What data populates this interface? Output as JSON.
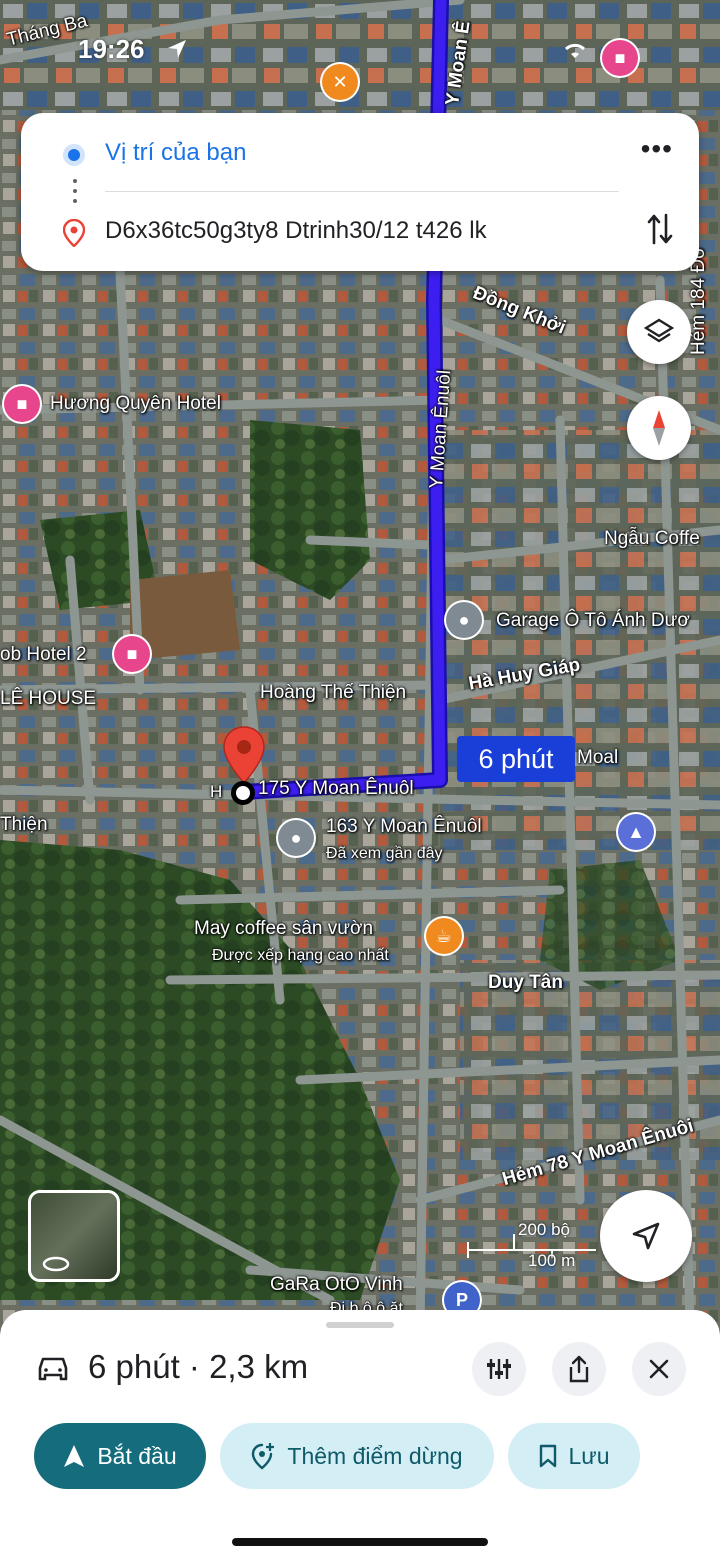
{
  "status_bar": {
    "time": "19:26"
  },
  "route_card": {
    "origin": "Vị trí của bạn",
    "destination": "D6x36tc50g3ty8 Dtrinh30/12 t426 lk"
  },
  "map": {
    "labels": {
      "thang_ba": "Tháng Ba",
      "y_moan_top": "Y Moan Ê",
      "hem_184": "Hẻm 184 Đồ",
      "dong_khoi": "Đồng Khởi",
      "y_moan_mid": "Y Moan Ênuôl",
      "huong_quyen": "Hương Quyên Hotel",
      "ngau_coffee": "Ngẫu Coffe",
      "garage": "Garage Ô Tô Ánh Dươ",
      "ha_huy_giap": "Hà Huy Giáp",
      "bob_hotel": "ob Hotel 2",
      "le_house": "LÊ HOUSE",
      "hoang_the_thien": "Hoàng Thế Thiện",
      "thien": "Thiện",
      "moal": "Moal",
      "dest_address": "175 Y Moan Ênuôl",
      "dest_prefix": "H",
      "place_163": "163 Y Moan Ênuôl",
      "place_163_sub": "Đã xem gần đây",
      "may_coffee": "May coffee sân vườn",
      "may_coffee_sub": "Được xếp hạng cao nhất",
      "duy_tan": "Duy Tân",
      "hem_78": "Hẻm 78 Y Moan Ênuôi",
      "gara_vinh": "GaRa OtO Vinh",
      "gara_vinh_sub": "Đi b ô ô ăt"
    },
    "eta_label": "6 phút",
    "scale": {
      "imperial": "200 bộ",
      "metric": "100 m"
    }
  },
  "sheet": {
    "summary": "6 phút · 2,3 km",
    "buttons": {
      "start": "Bắt đầu",
      "add_stop": "Thêm điểm dừng",
      "save": "Lưu"
    }
  },
  "colors": {
    "route": "#3d1ef0",
    "accent_teal": "#146c7c",
    "pill_light": "#d3eef5",
    "google_blue": "#1a73e8",
    "pin_red": "#ea4335",
    "hotel_pink": "#e8468c",
    "food_orange": "#f08a1e"
  }
}
